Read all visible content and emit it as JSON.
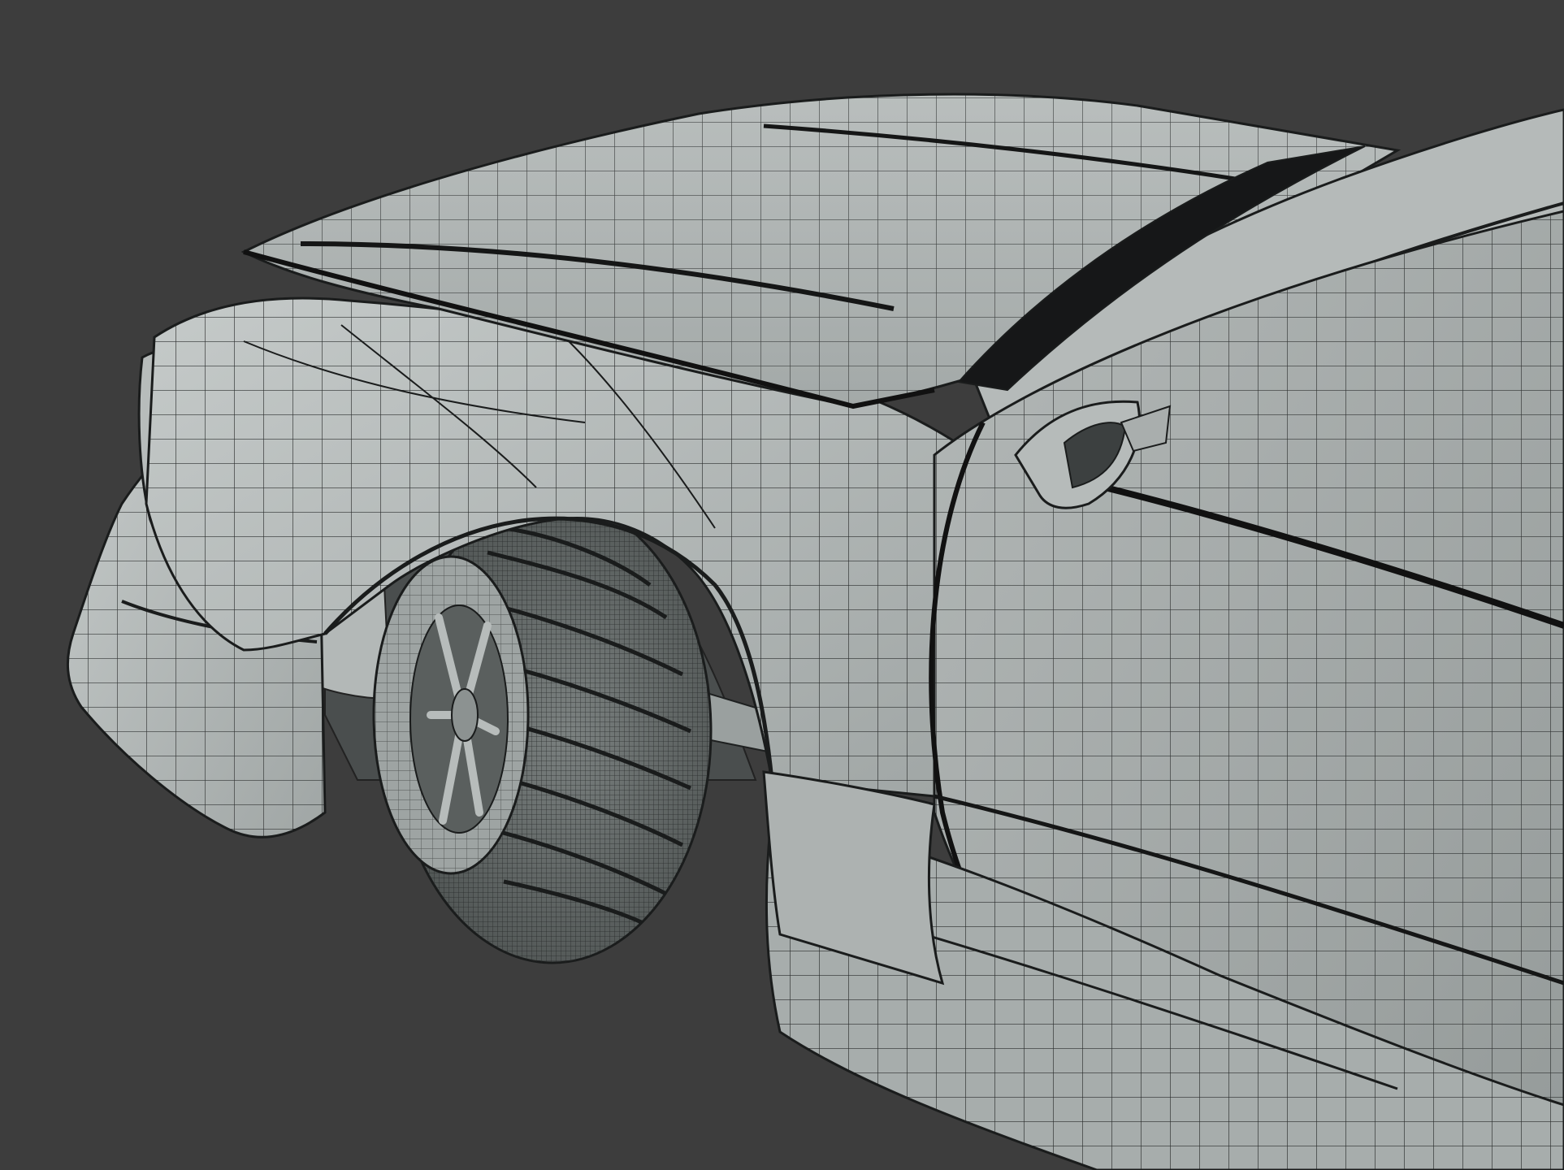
{
  "scene": {
    "view_type": "viewport-render",
    "subject": "car-front-left-quarter-wireframe",
    "shading": "solid-with-wireframe",
    "colors": {
      "background": "#3d3d3d",
      "shell": "#aab0af",
      "shell_light": "#c4c9c8",
      "shell_dark": "#868c8b",
      "wire": "#1a1c1c",
      "tire": "#5f6463",
      "gap": "#111213"
    }
  }
}
